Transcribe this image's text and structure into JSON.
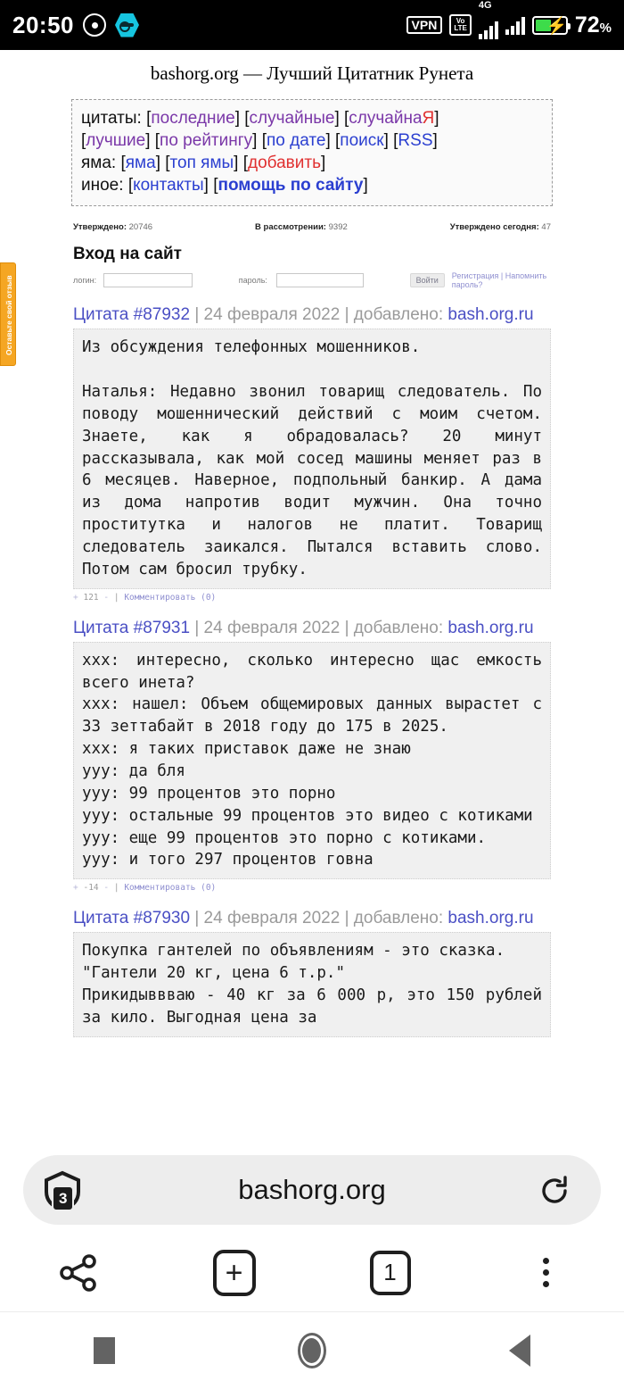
{
  "statusbar": {
    "time": "20:50",
    "icons": [
      "disc-icon",
      "hex-key-icon"
    ],
    "vpn_label": "VPN",
    "volte_top": "Vo",
    "volte_bottom": "LTE",
    "network_type": "4G",
    "battery_percent": "72",
    "percent_sign": "%"
  },
  "site": {
    "title": "bashorg.org — Лучший Цитатник Рунета"
  },
  "navbox": {
    "rows": [
      {
        "label": "цитаты:",
        "links": [
          {
            "text": "последние",
            "color": "purple"
          },
          {
            "text": "случайные",
            "color": "purple"
          },
          {
            "text": "случайна",
            "color": "purple",
            "suffix": "Я",
            "suffix_color": "red"
          }
        ]
      },
      {
        "label": "",
        "links": [
          {
            "text": "лучшие",
            "color": "purple"
          },
          {
            "text": "по рейтингу",
            "color": "purple"
          },
          {
            "text": "по дате",
            "color": "blue"
          },
          {
            "text": "поиск",
            "color": "blue"
          },
          {
            "text": "RSS",
            "color": "blue"
          }
        ]
      },
      {
        "label": "яма:",
        "links": [
          {
            "text": "яма",
            "color": "blue"
          },
          {
            "text": "топ ямы",
            "color": "blue"
          },
          {
            "text": "добавить",
            "color": "red"
          }
        ]
      },
      {
        "label": "иное:",
        "links": [
          {
            "text": "контакты",
            "color": "blue"
          },
          {
            "text": "помощь по сайту",
            "color": "blue",
            "bold": true
          }
        ]
      }
    ]
  },
  "stats": [
    {
      "label": "Утверждено:",
      "value": "20746"
    },
    {
      "label": "В рассмотрении:",
      "value": "9392"
    },
    {
      "label": "Утверждено сегодня:",
      "value": "47"
    }
  ],
  "login": {
    "title": "Вход на сайт",
    "login_label": "логин:",
    "login_value": "",
    "password_label": "пароль:",
    "password_value": "",
    "submit_label": "Войти",
    "register_link": "Регистрация",
    "separator": "|",
    "remind_link": "Напомнить пароль?"
  },
  "feedback_tab": {
    "text": "Оставьте свой отзыв"
  },
  "quotes": [
    {
      "id_label": "Цитата #87932",
      "sep1": " | ",
      "date": "24 февраля 2022",
      "sep2": " | добавлено: ",
      "source": "bash.org.ru",
      "body": "Из обсуждения телефонных мошенников.\n\nНаталья: Недавно звонил товарищ следователь. По поводу мошеннический действий с моим счетом. Знаете, как я обрадовалась? 20 минут рассказывала, как мой сосед машины меняет раз в 6 месяцев. Наверное, подпольный банкир. А дама из дома напротив водит мужчин. Она точно проститутка и налогов не платит. Товарищ следователь заикался. Пытался вставить слово. Потом сам бросил трубку.",
      "rating": "121",
      "plus": "+",
      "minus": "-",
      "divider": "|",
      "comment_label": "Комментировать (0)"
    },
    {
      "id_label": "Цитата #87931",
      "sep1": " | ",
      "date": "24 февраля 2022",
      "sep2": " | добавлено: ",
      "source": "bash.org.ru",
      "body": "xxx: интересно, сколько интересно щас емкость всего инета?\nxxx: нашел: Объем общемировых данных вырастет с 33 зеттабайт в 2018 году до 175 в 2025.\nxxx: я таких приставок даже не знаю\nyyy: да бля\nyyy: 99 процентов это порно\nyyy: остальные 99 процентов это видео с котиками\nyyy: еще 99 процентов это порно с котиками.\nyyy: и того 297 процентов говна",
      "rating": "-14",
      "plus": "+",
      "minus": "-",
      "divider": "|",
      "comment_label": "Комментировать (0)"
    },
    {
      "id_label": "Цитата #87930",
      "sep1": " | ",
      "date": "24 февраля 2022",
      "sep2": " | добавлено: ",
      "source": "bash.org.ru",
      "body": "Покупка гантелей по объявлениям - это сказка.\n\"Гантели 20 кг, цена 6 т.р.\"\nПрикидыввваю - 40 кг за 6 000 р, это 150 рублей за кило. Выгодная цена за",
      "rating": "",
      "plus": "+",
      "minus": "-",
      "divider": "|",
      "comment_label": ""
    }
  ],
  "browser": {
    "url": "bashorg.org",
    "shield_icon": "shield-icon",
    "blocked_count": "3",
    "reload_icon": "reload-icon",
    "toolbar": {
      "share_icon": "share-icon",
      "new_tab_label": "+",
      "tab_count": "1",
      "menu_icon": "kebab-menu-icon"
    }
  },
  "navbar": {
    "recents_label": "recents-button",
    "home_label": "home-button",
    "back_label": "back-button"
  }
}
